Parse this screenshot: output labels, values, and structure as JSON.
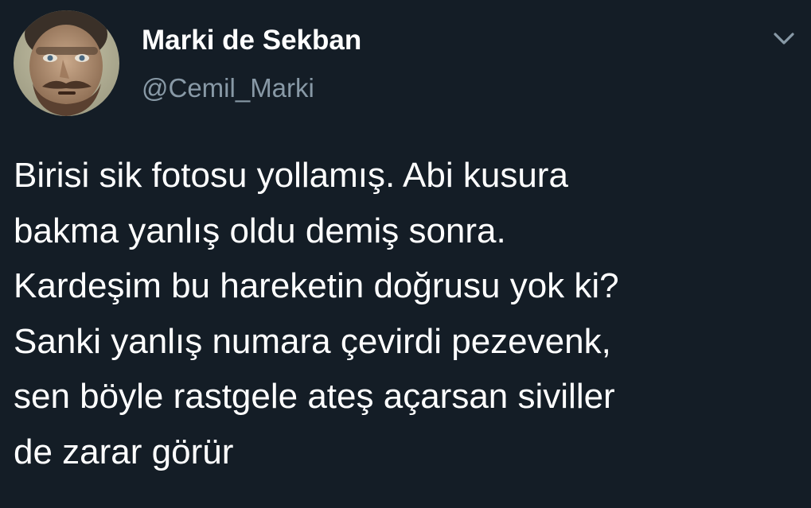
{
  "theme": {
    "background": "#141d26",
    "text_primary": "#ffffff",
    "text_secondary": "#8899a6"
  },
  "author": {
    "display_name": "Marki de Sekban",
    "handle": "@Cemil_Marki",
    "avatar_icon": "user-avatar-photo"
  },
  "header": {
    "menu_icon": "chevron-down-icon"
  },
  "tweet": {
    "lines": [
      "Birisi sik fotosu yollamış. Abi kusura",
      "bakma yanlış oldu demiş sonra.",
      "Kardeşim bu hareketin doğrusu yok ki?",
      "Sanki yanlış numara çevirdi pezevenk,",
      "sen böyle rastgele ateş açarsan siviller",
      "de zarar görür"
    ]
  }
}
